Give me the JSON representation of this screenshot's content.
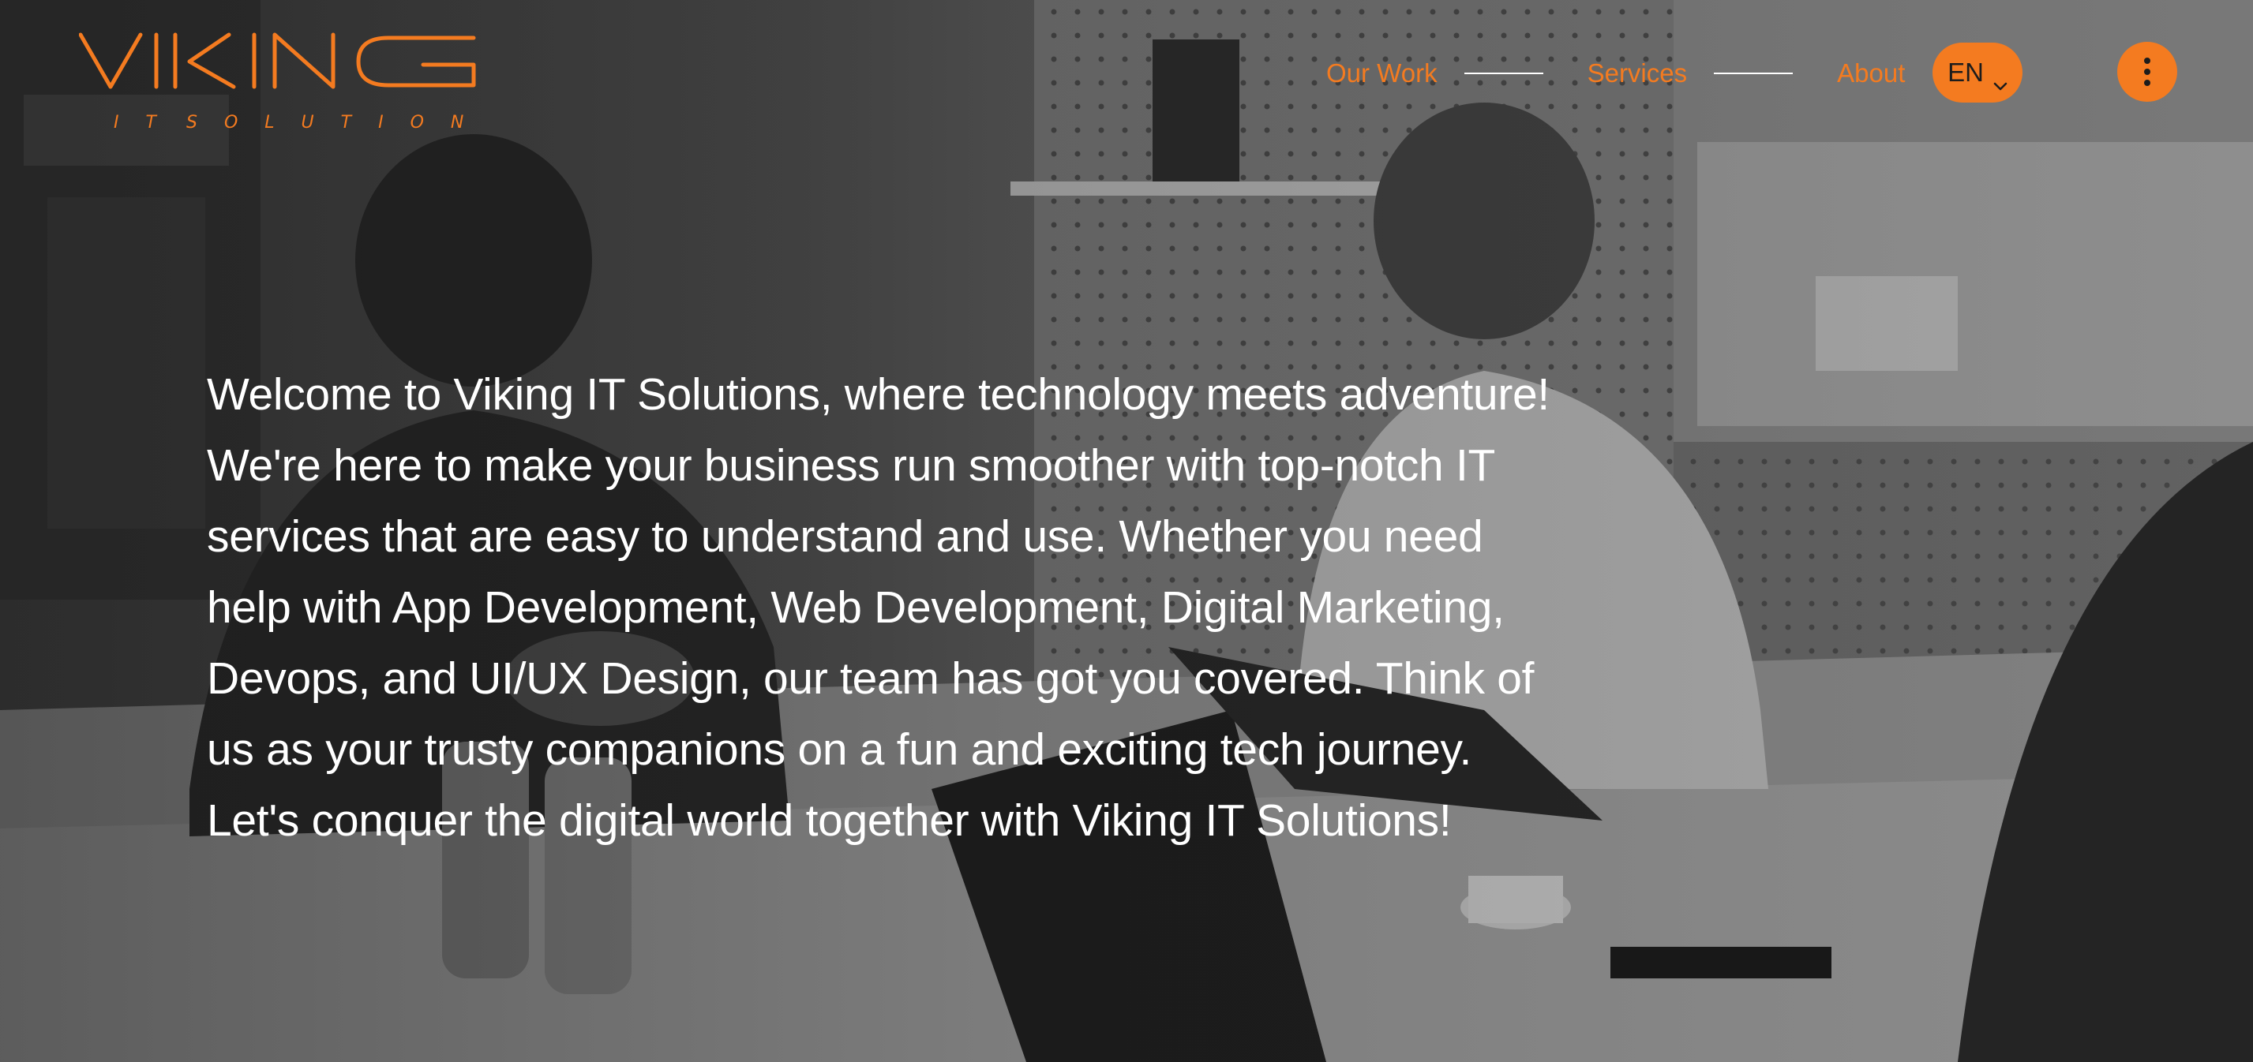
{
  "colors": {
    "accent": "#f47b20",
    "text": "#ffffff",
    "background": "#3a3a3a"
  },
  "logo": {
    "name": "VIKING",
    "tagline": "IT SOLUTIONS"
  },
  "nav": {
    "items": [
      {
        "label": "Our Work"
      },
      {
        "label": "Services"
      },
      {
        "label": "About"
      }
    ]
  },
  "language": {
    "selected": "EN",
    "icon": "chevron-down-icon"
  },
  "menu": {
    "icon": "vertical-dots-icon"
  },
  "hero": {
    "intro_text": "Welcome to Viking IT Solutions, where technology meets adventure! We're here to make your business run smoother with top-notch IT services that are easy to understand and use. Whether you need help with App Development, Web Development, Digital Marketing, Devops, and UI/UX Design, our team has got you covered. Think of us as your trusty companions on a fun and exciting tech journey. Let's conquer the digital world together with Viking IT Solutions!"
  }
}
